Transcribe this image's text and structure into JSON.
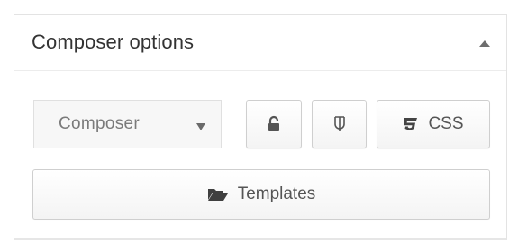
{
  "panel": {
    "title": "Composer options"
  },
  "icons": {
    "collapse": "triangle-up-icon",
    "dropdown": "caret-down-icon",
    "lock": "unlock-icon",
    "publish": "publish-glyph-icon",
    "css": "css3-icon",
    "templates": "folder-open-icon"
  },
  "composer_select": {
    "value": "Composer"
  },
  "buttons": {
    "css_label": "CSS",
    "templates_label": "Templates"
  },
  "colors": {
    "text": "#333333",
    "button_text": "#555555",
    "border": "#cfcfcf",
    "select_bg": "#f7f7f7"
  }
}
